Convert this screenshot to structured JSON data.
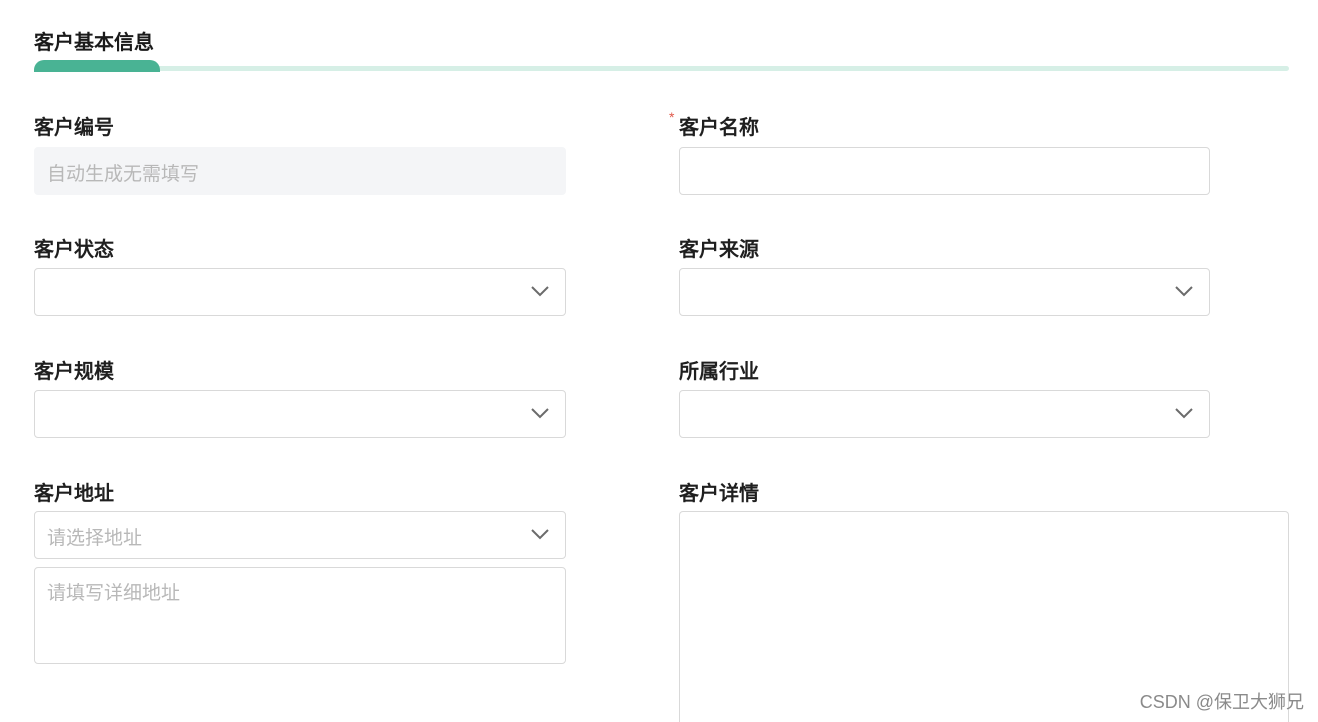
{
  "section": {
    "title": "客户基本信息"
  },
  "fields": {
    "customer_no": {
      "label": "客户编号",
      "placeholder": "自动生成无需填写"
    },
    "customer_name": {
      "label": "客户名称",
      "required_mark": "*",
      "value": ""
    },
    "customer_status": {
      "label": "客户状态",
      "value": ""
    },
    "customer_source": {
      "label": "客户来源",
      "value": ""
    },
    "customer_scale": {
      "label": "客户规模",
      "value": ""
    },
    "industry": {
      "label": "所属行业",
      "value": ""
    },
    "address": {
      "label": "客户地址",
      "select_placeholder": "请选择地址",
      "detail_placeholder": "请填写详细地址"
    },
    "details": {
      "label": "客户详情",
      "value": ""
    }
  },
  "watermark": "CSDN @保卫大狮兄",
  "colors": {
    "accent": "#49b394",
    "accent_light": "#d6efe6",
    "required": "#e0584a",
    "border": "#d9d9d9",
    "disabled_bg": "#f4f5f7",
    "placeholder": "#b8b8b8"
  },
  "icons": {
    "dropdown": "chevron-down-icon"
  }
}
